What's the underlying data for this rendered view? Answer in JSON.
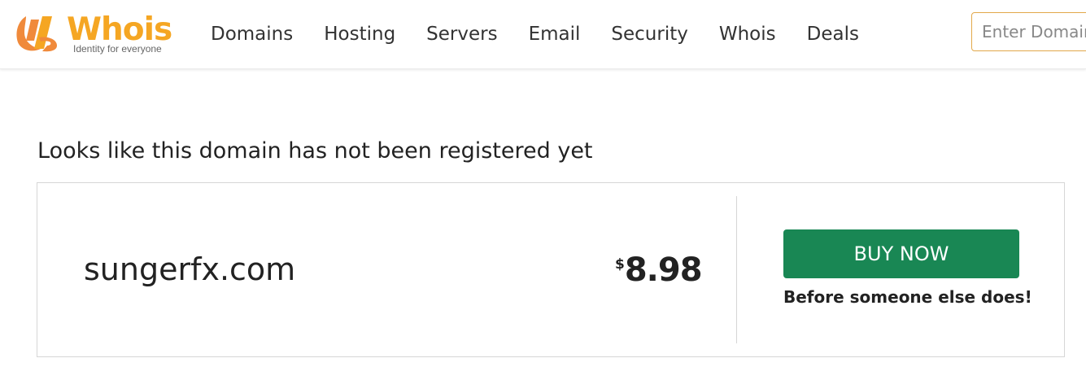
{
  "header": {
    "logo": {
      "wordmark": "Whois",
      "tagline": "Identity for everyone",
      "icon": "whois-logo-icon",
      "brand_colors": [
        "#f08a3b",
        "#f5a623"
      ]
    },
    "nav": {
      "items": [
        {
          "label": "Domains"
        },
        {
          "label": "Hosting"
        },
        {
          "label": "Servers"
        },
        {
          "label": "Email"
        },
        {
          "label": "Security"
        },
        {
          "label": "Whois"
        },
        {
          "label": "Deals"
        }
      ]
    },
    "search": {
      "placeholder": "Enter Domain"
    }
  },
  "main": {
    "notice": "Looks like this domain has not been registered yet",
    "result": {
      "domain": "sungerfx.com",
      "currency_symbol": "$",
      "price": "8.98",
      "buy_label": "BUY NOW",
      "buy_note": "Before someone else does!",
      "buy_color": "#198754"
    }
  }
}
